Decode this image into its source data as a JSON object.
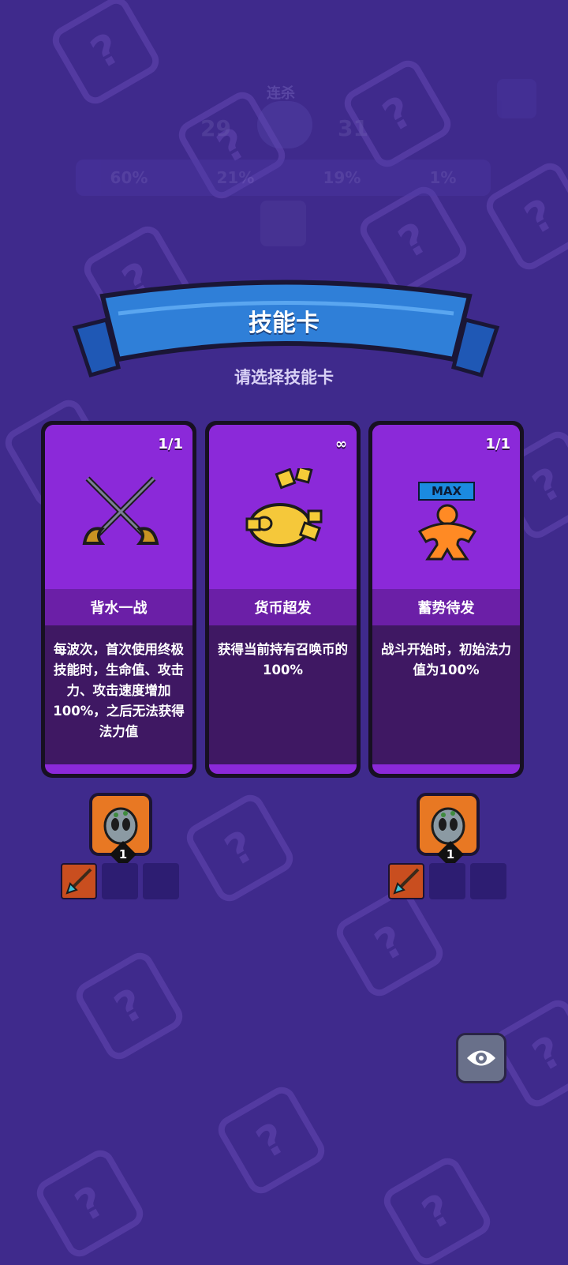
{
  "top_hud": {
    "score_label": "连杀",
    "score_left": "29",
    "score_right": "31",
    "stats": [
      "60%",
      "21%",
      "19%",
      "1%"
    ],
    "menu_icon": "menu-icon"
  },
  "banner": {
    "title": "技能卡",
    "subtitle": "请选择技能卡"
  },
  "cards": [
    {
      "count": "1/1",
      "name": "背水一战",
      "description": "每波次，首次使用终极技能时，生命值、攻击力、攻击速度增加100%，之后无法获得法力值",
      "icon": "crossed-swords-icon"
    },
    {
      "count": "∞",
      "name": "货币超发",
      "description": "获得当前持有召唤币的100%",
      "icon": "golden-piggy-bank-icon"
    },
    {
      "count": "1/1",
      "name": "蓄势待发",
      "description": "战斗开始时，初始法力值为100%",
      "icon": "max-power-figure-icon",
      "badge": "MAX"
    }
  ],
  "units": [
    {
      "level": "1",
      "icon": "goblin-unit-icon",
      "equipment_icon": "spear-icon"
    },
    {
      "level": "1",
      "icon": "goblin-unit-icon",
      "equipment_icon": "spear-icon"
    }
  ],
  "colors": {
    "background": "#3f2a8c",
    "card_top": "#8b29d9",
    "card_desc": "#3f1863",
    "banner": "#2f7fd8"
  },
  "eye_button_icon": "eye-icon"
}
